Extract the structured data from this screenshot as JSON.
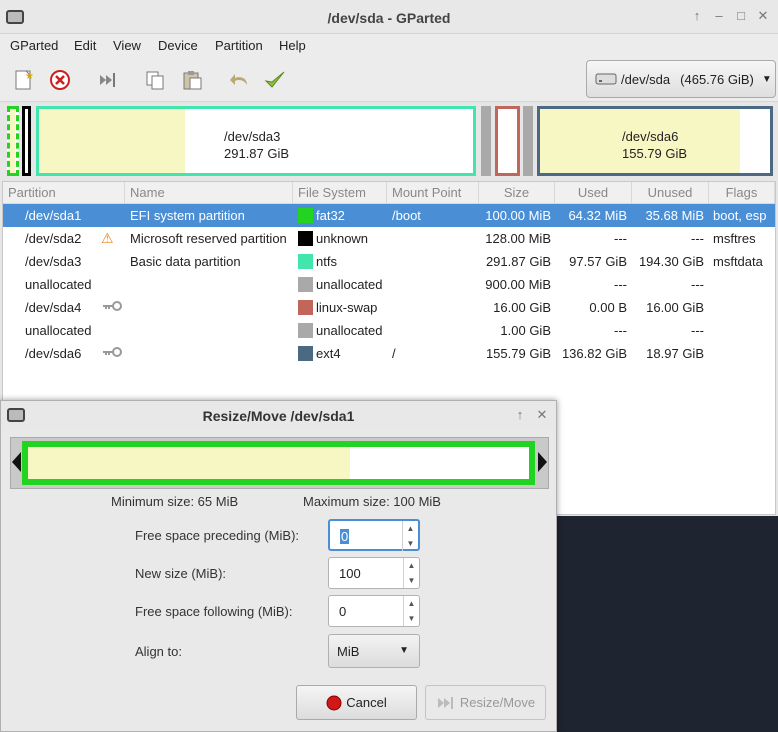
{
  "window": {
    "title": "/dev/sda - GParted"
  },
  "menu": [
    "GParted",
    "Edit",
    "View",
    "Device",
    "Partition",
    "Help"
  ],
  "toolbar": {
    "icons": [
      "new-icon",
      "delete-icon",
      "resize-move-icon",
      "copy-icon",
      "paste-icon",
      "undo-icon",
      "apply-icon"
    ]
  },
  "device": {
    "name": "/dev/sda",
    "size": "(465.76 GiB)"
  },
  "diskmap": {
    "sda3": {
      "name": "/dev/sda3",
      "size": "291.87 GiB"
    },
    "sda6": {
      "name": "/dev/sda6",
      "size": "155.79 GiB"
    }
  },
  "table": {
    "headers": [
      "Partition",
      "Name",
      "File System",
      "Mount Point",
      "Size",
      "Used",
      "Unused",
      "Flags"
    ],
    "rows": [
      {
        "partition": "/dev/sda1",
        "name": "EFI system partition",
        "fs": "fat32",
        "fs_color": "#22d322",
        "mount": "/boot",
        "size": "100.00 MiB",
        "used": "64.32 MiB",
        "unused": "35.68 MiB",
        "flags": "boot, esp",
        "icon": "",
        "selected": true
      },
      {
        "partition": "/dev/sda2",
        "name": "Microsoft reserved partition",
        "fs": "unknown",
        "fs_color": "#000000",
        "mount": "",
        "size": "128.00 MiB",
        "used": "---",
        "unused": "---",
        "flags": "msftres",
        "icon": "warning-icon",
        "selected": false
      },
      {
        "partition": "/dev/sda3",
        "name": "Basic data partition",
        "fs": "ntfs",
        "fs_color": "#42e5ac",
        "mount": "",
        "size": "291.87 GiB",
        "used": "97.57 GiB",
        "unused": "194.30 GiB",
        "flags": "msftdata",
        "icon": "",
        "selected": false
      },
      {
        "partition": "unallocated",
        "name": "",
        "fs": "unallocated",
        "fs_color": "#a9a9a9",
        "mount": "",
        "size": "900.00 MiB",
        "used": "---",
        "unused": "---",
        "flags": "",
        "icon": "",
        "selected": false
      },
      {
        "partition": "/dev/sda4",
        "name": "",
        "fs": "linux-swap",
        "fs_color": "#c1665a",
        "mount": "",
        "size": "16.00 GiB",
        "used": "0.00 B",
        "unused": "16.00 GiB",
        "flags": "",
        "icon": "key-icon",
        "selected": false
      },
      {
        "partition": "unallocated",
        "name": "",
        "fs": "unallocated",
        "fs_color": "#a9a9a9",
        "mount": "",
        "size": "1.00 GiB",
        "used": "---",
        "unused": "---",
        "flags": "",
        "icon": "",
        "selected": false
      },
      {
        "partition": "/dev/sda6",
        "name": "",
        "fs": "ext4",
        "fs_color": "#4b6983",
        "mount": "/",
        "size": "155.79 GiB",
        "used": "136.82 GiB",
        "unused": "18.97 GiB",
        "flags": "",
        "icon": "key-icon",
        "selected": false
      }
    ]
  },
  "dialog": {
    "title": "Resize/Move /dev/sda1",
    "min_size": "Minimum size: 65 MiB",
    "max_size": "Maximum size: 100 MiB",
    "used_fraction": 0.643,
    "fields": {
      "free_preceding_label": "Free space preceding (MiB):",
      "free_preceding_value": "0",
      "new_size_label": "New size (MiB):",
      "new_size_value": "100",
      "free_following_label": "Free space following (MiB):",
      "free_following_value": "0",
      "align_label": "Align to:",
      "align_value": "MiB"
    },
    "cancel_label": "Cancel",
    "resize_label": "Resize/Move"
  }
}
